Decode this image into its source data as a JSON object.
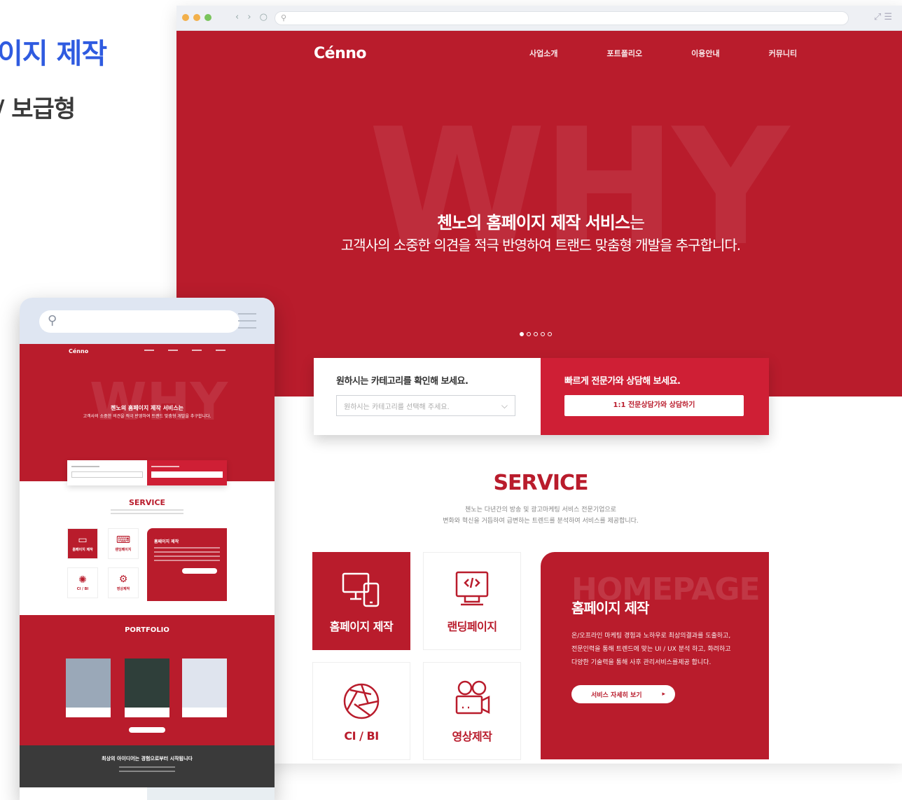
{
  "side_heading": {
    "title": "이지 제작",
    "subtitle": "/ 보급형"
  },
  "desktop": {
    "logo": "Cénno",
    "nav": [
      "사업소개",
      "포트폴리오",
      "이용안내",
      "커뮤니티"
    ],
    "hero_bg_word": "WHY",
    "hero_title_bold": "첸노의 홈페이지 제작 서비스",
    "hero_title_suffix": "는",
    "hero_subtitle": "고객사의 소중한 의견을 적극 반영하여 트랜드 맞춤형 개발을 추구합니다.",
    "slider_dots": 5,
    "category": {
      "label": "원하시는 카테고리를 확인해 보세요.",
      "placeholder": "원하시는 카테고리를 선택해 주세요."
    },
    "consult": {
      "label": "빠르게 전문가와 상담해 보세요.",
      "button": "1:1 전문상담가와 상담하기"
    },
    "service": {
      "title": "SERVICE",
      "desc_line1": "첸노는 다년간의 방송 및 광고마케팅 서비스 전문기업으로",
      "desc_line2": "변화와 혁신을 거듭하여 급변하는 트렌드를 분석하여 서비스를 제공합니다.",
      "tiles": [
        "홈페이지 제작",
        "랜딩페이지",
        "CI / BI",
        "영상제작"
      ]
    },
    "detail": {
      "bg_word": "HOMEPAGE",
      "title": "홈페이지 제작",
      "desc": "온/오프라인 마케팅 경험과 노하우로 최상의결과를 도출하고, 전문인력을 통해 트렌드에 맞는 UI / UX 분석 하고, 화려하고 다양한 기술력을 통해 사후 관리서비스를제공 합니다.",
      "button": "서비스 자세히 보기"
    }
  },
  "mobile": {
    "logo": "Cénno",
    "hero_bg_word": "WHY",
    "hero_title": "첸노의 홈페이지 제작 서비스는",
    "hero_subtitle": "고객사의 소중한 의견을 적극 반영하여 트랜드 맞춤형 개발을 추구합니다.",
    "service_title": "SERVICE",
    "tiles": [
      "홈페이지 제작",
      "랜딩페이지",
      "CI / BI",
      "영상제작"
    ],
    "detail_title": "홈페이지 제작",
    "portfolio_title": "PORTFOLIO",
    "footer_text": "최상의 아이디어는 경험으로부터 시작됩니다"
  },
  "colors": {
    "brand_red": "#b91c2c",
    "accent_blue": "#2f5be0"
  }
}
